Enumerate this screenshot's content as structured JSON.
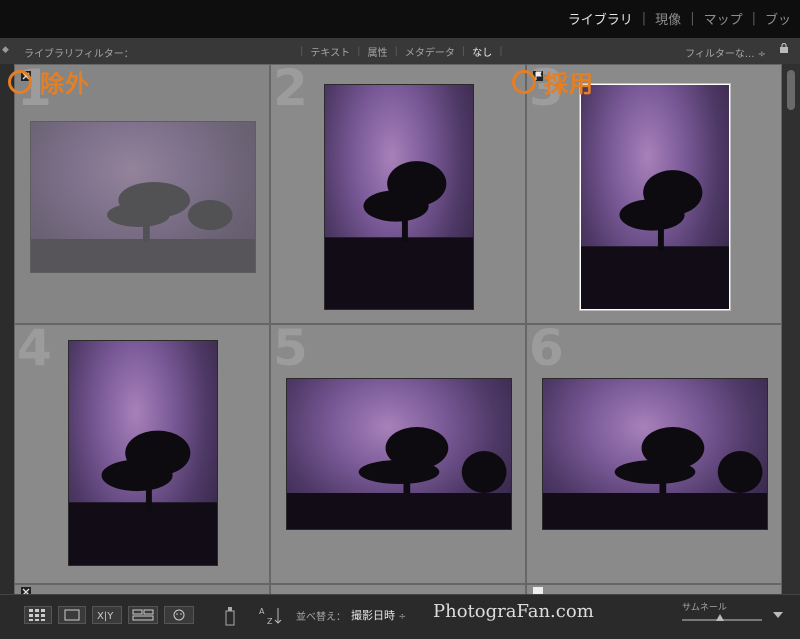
{
  "header": {
    "modules": [
      {
        "label": "ライブラリ",
        "active": true
      },
      {
        "label": "現像",
        "active": false
      },
      {
        "label": "マップ",
        "active": false
      },
      {
        "label": "ブッ",
        "active": false
      }
    ]
  },
  "filter_bar": {
    "label": "ライブラリフィルター：",
    "tabs": [
      {
        "label": "テキスト",
        "active": false
      },
      {
        "label": "属性",
        "active": false
      },
      {
        "label": "メタデータ",
        "active": false
      },
      {
        "label": "なし",
        "active": true
      }
    ],
    "preset": "フィルターな...",
    "lock_icon": "lock-icon"
  },
  "grid": {
    "cells": [
      {
        "number": "1",
        "flag": "rejected",
        "faded": true,
        "orientation": "landscape"
      },
      {
        "number": "2",
        "flag": "none",
        "faded": false,
        "orientation": "portrait"
      },
      {
        "number": "3",
        "flag": "picked",
        "faded": false,
        "orientation": "portrait",
        "selected": true
      },
      {
        "number": "4",
        "flag": "none",
        "faded": false,
        "orientation": "portrait"
      },
      {
        "number": "5",
        "flag": "none",
        "faded": false,
        "orientation": "landscape"
      },
      {
        "number": "6",
        "flag": "none",
        "faded": false,
        "orientation": "landscape"
      }
    ]
  },
  "annotations": {
    "reject_label": "除外",
    "pick_label": "採用",
    "color": "#e67e22"
  },
  "toolbar": {
    "sort_label": "並べ替え：",
    "sort_value": "撮影日時",
    "watermark": "PhotograFan.com",
    "thumbnail_label": "サムネール"
  }
}
